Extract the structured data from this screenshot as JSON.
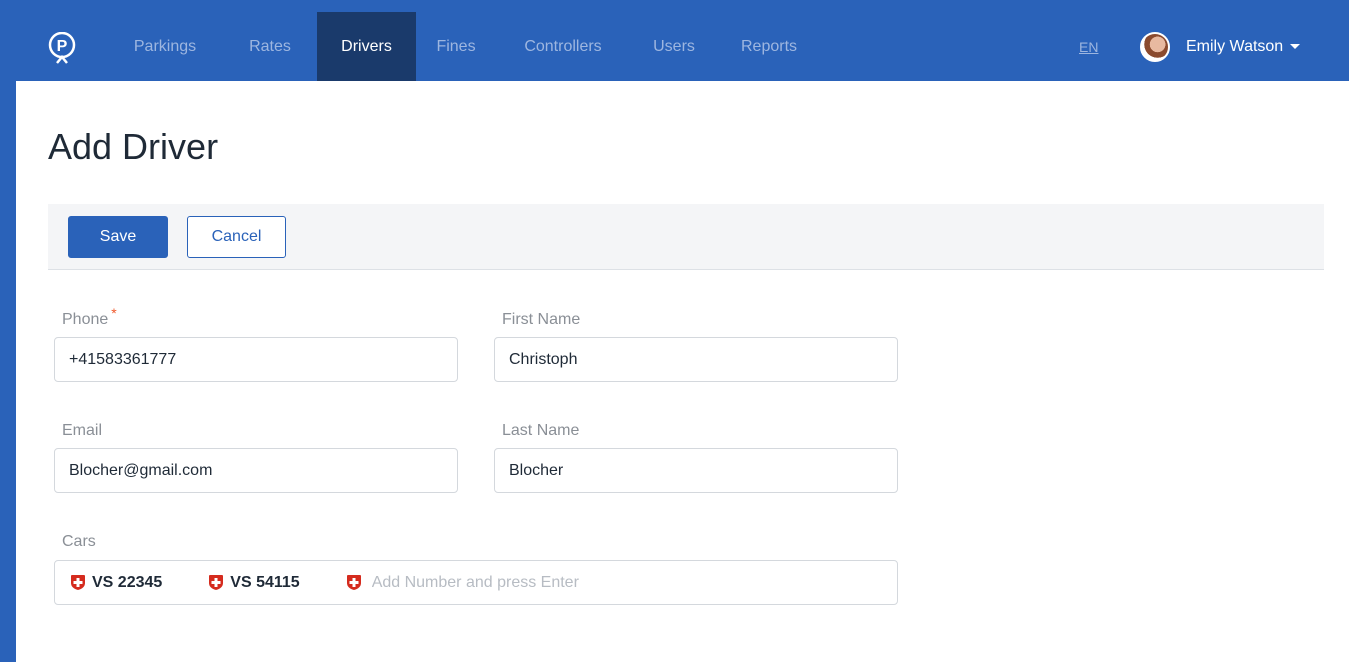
{
  "nav": {
    "items": [
      {
        "label": "Parkings",
        "active": false
      },
      {
        "label": "Rates",
        "active": false
      },
      {
        "label": "Drivers",
        "active": true
      },
      {
        "label": "Fines",
        "active": false
      },
      {
        "label": "Controllers",
        "active": false
      },
      {
        "label": "Users",
        "active": false
      },
      {
        "label": "Reports",
        "active": false
      }
    ],
    "lang": "EN",
    "user_name": "Emily Watson"
  },
  "page": {
    "title": "Add Driver"
  },
  "toolbar": {
    "save_label": "Save",
    "cancel_label": "Cancel"
  },
  "form": {
    "phone": {
      "label": "Phone",
      "required_mark": "*",
      "value": "+41583361777"
    },
    "first_name": {
      "label": "First Name",
      "value": "Christoph"
    },
    "email": {
      "label": "Email",
      "value": "Blocher@gmail.com"
    },
    "last_name": {
      "label": "Last Name",
      "value": "Blocher"
    },
    "cars": {
      "label": "Cars",
      "items": [
        "VS 22345",
        "VS 54115"
      ],
      "placeholder": "Add Number and press Enter"
    }
  },
  "colors": {
    "brand": "#2a62b9",
    "nav_active": "#1a3a6b",
    "required": "#f0582b",
    "swiss_flag": "#d52b1e"
  },
  "icons": {
    "logo": "parking-logo-icon",
    "avatar": "user-avatar",
    "user_menu": "chevron-down-icon",
    "car_flag": "swiss-flag-icon"
  }
}
